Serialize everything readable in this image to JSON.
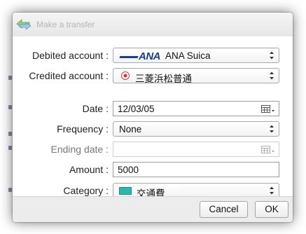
{
  "dialog": {
    "title": "Make a transfer",
    "icon": "transfer-arrows-icon"
  },
  "form": {
    "debited_account": {
      "label": "Debited account :",
      "value": "ANA Suica",
      "logo": "ANA",
      "icon": "ana-logo-icon"
    },
    "credited_account": {
      "label": "Credited account :",
      "value": "三菱浜松普通",
      "icon": "bank-logo-icon"
    },
    "date": {
      "label": "Date :",
      "value": "12/03/05",
      "icon": "calendar-icon"
    },
    "frequency": {
      "label": "Frequency :",
      "value": "None"
    },
    "ending_date": {
      "label": "Ending date :",
      "value": "",
      "enabled": false,
      "icon": "calendar-icon"
    },
    "amount": {
      "label": "Amount :",
      "value": "5000"
    },
    "category": {
      "label": "Category :",
      "value": "交通費",
      "color": "#2cb7ae"
    }
  },
  "buttons": {
    "cancel": "Cancel",
    "ok": "OK"
  }
}
